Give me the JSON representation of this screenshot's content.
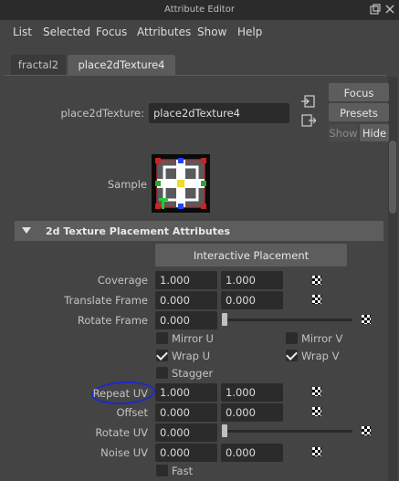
{
  "window": {
    "title": "Attribute Editor"
  },
  "menu": [
    "List",
    "Selected",
    "Focus",
    "Attributes",
    "Show",
    "Help"
  ],
  "tabs": [
    {
      "label": "fractal2",
      "active": false
    },
    {
      "label": "place2dTexture4",
      "active": true
    }
  ],
  "node": {
    "label": "place2dTexture:",
    "value": "place2dTexture4",
    "focus_label": "Focus",
    "presets_label": "Presets",
    "show_label": "Show",
    "hide_label": "Hide",
    "sample_label": "Sample"
  },
  "section": {
    "title": "2d Texture Placement Attributes",
    "interactive_label": "Interactive Placement"
  },
  "attrs": {
    "coverage": {
      "label": "Coverage",
      "v1": "1.000",
      "v2": "1.000"
    },
    "translate_frame": {
      "label": "Translate Frame",
      "v1": "0.000",
      "v2": "0.000"
    },
    "rotate_frame": {
      "label": "Rotate Frame",
      "v1": "0.000",
      "slider": 0.0
    },
    "mirror_u": {
      "label": "Mirror U",
      "checked": false
    },
    "mirror_v": {
      "label": "Mirror V",
      "checked": false
    },
    "wrap_u": {
      "label": "Wrap U",
      "checked": true
    },
    "wrap_v": {
      "label": "Wrap V",
      "checked": true
    },
    "stagger": {
      "label": "Stagger",
      "checked": false
    },
    "repeat_uv": {
      "label": "Repeat UV",
      "v1": "1.000",
      "v2": "1.000"
    },
    "offset": {
      "label": "Offset",
      "v1": "0.000",
      "v2": "0.000"
    },
    "rotate_uv": {
      "label": "Rotate UV",
      "v1": "0.000",
      "slider": 0.0
    },
    "noise_uv": {
      "label": "Noise UV",
      "v1": "0.000",
      "v2": "0.000"
    },
    "fast": {
      "label": "Fast",
      "checked": false
    }
  },
  "colors": {
    "annotation": "#1e28c8",
    "panel": "#444444",
    "field": "#2b2b2b"
  }
}
